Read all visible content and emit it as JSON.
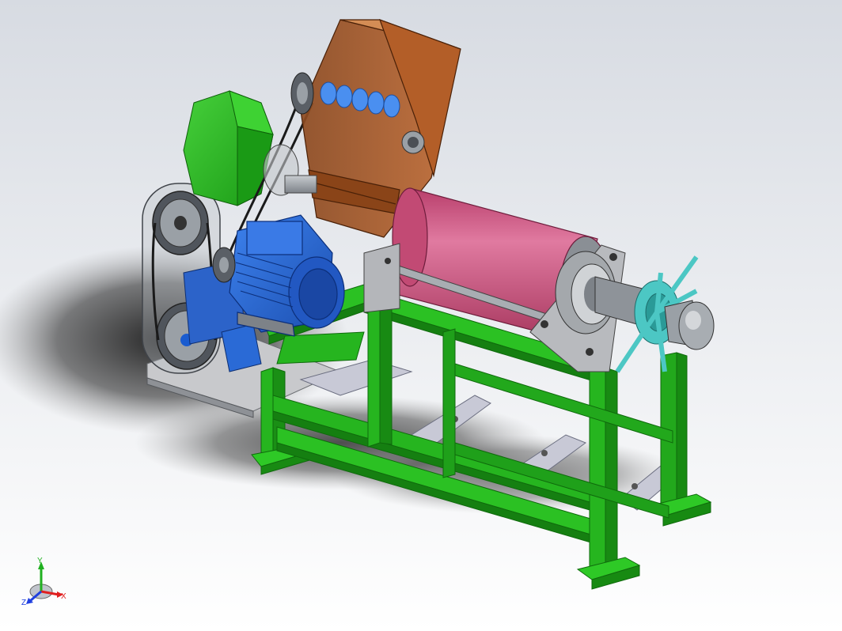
{
  "viewport": {
    "background_top": "#d9dce3",
    "background_bottom": "#ffffff"
  },
  "colors": {
    "frame_green": "#26b51f",
    "frame_green_dark": "#178a12",
    "frame_green_light": "#4fd344",
    "hopper_brown": "#a85a2a",
    "hopper_brown_dark": "#7b3d18",
    "hopper_brown_light": "#c9783e",
    "cylinder_pink": "#c8507a",
    "cylinder_pink_light": "#e27aa0",
    "motor_blue": "#2a6ad6",
    "motor_blue_dark": "#1a4aa8",
    "steel_gray": "#9aa0a6",
    "steel_dark": "#5a5f66",
    "teal": "#4cc7c4",
    "paddle_blue": "#4a8ff0",
    "shadow": "#222222"
  },
  "triad": {
    "x_label": "X",
    "y_label": "Y",
    "z_label": "Z",
    "x_color": "#e02020",
    "y_color": "#20b020",
    "z_color": "#2040e0"
  }
}
